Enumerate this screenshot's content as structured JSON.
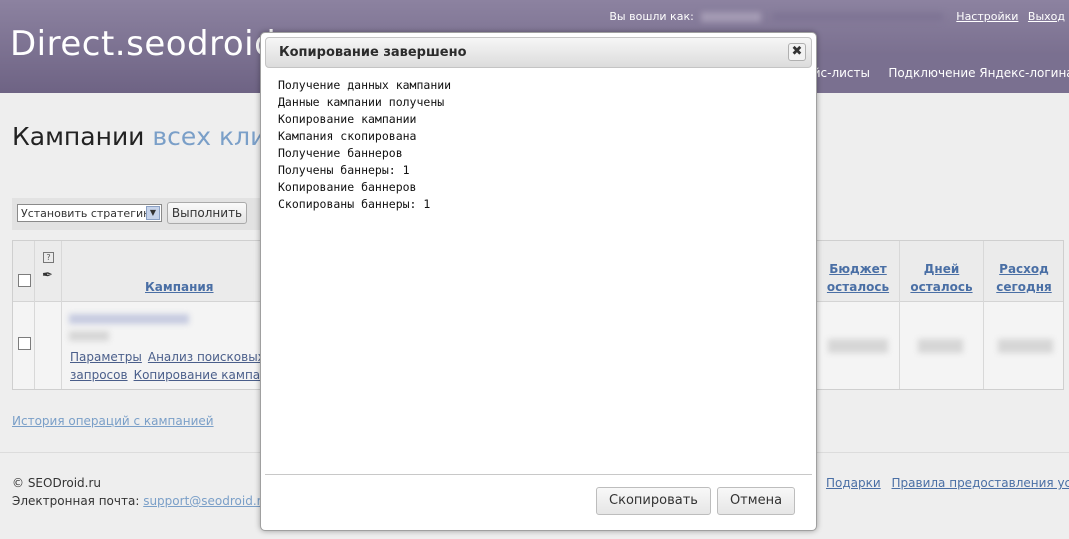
{
  "header": {
    "logo": "Direct.seodroid.",
    "logged_in_label": "Вы вошли как:",
    "settings_link": "Настройки",
    "logout_link": "Выход",
    "tabs": [
      "йс-листы",
      "Подключение Яндекс-логина"
    ]
  },
  "page": {
    "title": "Кампании",
    "title_suffix": "всех клиен"
  },
  "toolbar": {
    "strategy_select": "Установить стратегию",
    "run_button": "Выполнить"
  },
  "table": {
    "headers": {
      "campaign": "Кампания",
      "budget": [
        "Бюджет",
        "осталось"
      ],
      "days": [
        "Дней",
        "осталось"
      ],
      "spend": [
        "Расход",
        "сегодня"
      ]
    },
    "row_links": {
      "params": "Параметры",
      "search_analysis_1": "Анализ поисковых",
      "search_analysis_2": "запросов",
      "copy_campaign": "Копирование кампани"
    },
    "help_icon": "?"
  },
  "history_link": "История операций с кампанией",
  "footer": {
    "copyright": "© SEODroid.ru",
    "email_label": "Электронная почта:",
    "email": "support@seodroid.ru",
    "links": [
      "Подарки",
      "Правила предоставления услуг"
    ]
  },
  "modal": {
    "title": "Копирование завершено",
    "close_icon": "✖",
    "log": [
      "Получение данных кампании",
      "Данные кампании получены",
      "Копирование кампании",
      "Кампания скопирована",
      "Получение баннеров",
      "Получены баннеры: 1",
      "Копирование баннеров",
      "Скопированы баннеры: 1"
    ],
    "copy_button": "Скопировать",
    "cancel_button": "Отмена"
  }
}
